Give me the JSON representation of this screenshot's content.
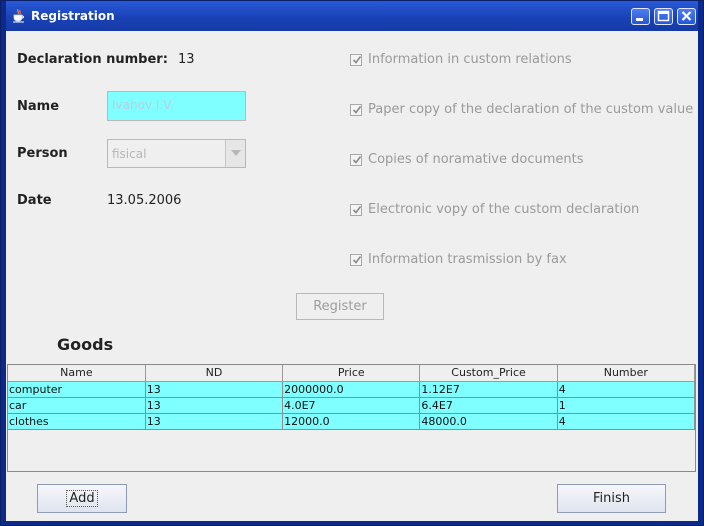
{
  "window": {
    "title": "Registration"
  },
  "form": {
    "declaration_label": "Declaration number:",
    "declaration_value": "13",
    "name_label": "Name",
    "name_value": "Ivanov I.V.",
    "person_label": "Person",
    "person_value": "fisical",
    "date_label": "Date",
    "date_value": "13.05.2006"
  },
  "checklist": [
    {
      "label": "Information in custom relations",
      "checked": true
    },
    {
      "label": "Paper copy of the declaration of the custom value",
      "checked": true
    },
    {
      "label": "Copies of noramative documents",
      "checked": true
    },
    {
      "label": "Electronic vopy of the custom declaration",
      "checked": true
    },
    {
      "label": "Information trasmission by fax",
      "checked": true
    }
  ],
  "register_label": "Register",
  "goods": {
    "title": "Goods",
    "columns": [
      "Name",
      "ND",
      "Price",
      "Custom_Price",
      "Number"
    ],
    "rows": [
      [
        "computer",
        "13",
        "2000000.0",
        "1.12E7",
        "4"
      ],
      [
        "car",
        "13",
        "4.0E7",
        "6.4E7",
        "1"
      ],
      [
        "clothes",
        "13",
        "12000.0",
        "48000.0",
        "4"
      ]
    ]
  },
  "buttons": {
    "add": "Add",
    "finish": "Finish"
  },
  "colors": {
    "titlebar": "#1942b6",
    "highlight": "#7fffff",
    "frame": "#0b2a8a"
  }
}
